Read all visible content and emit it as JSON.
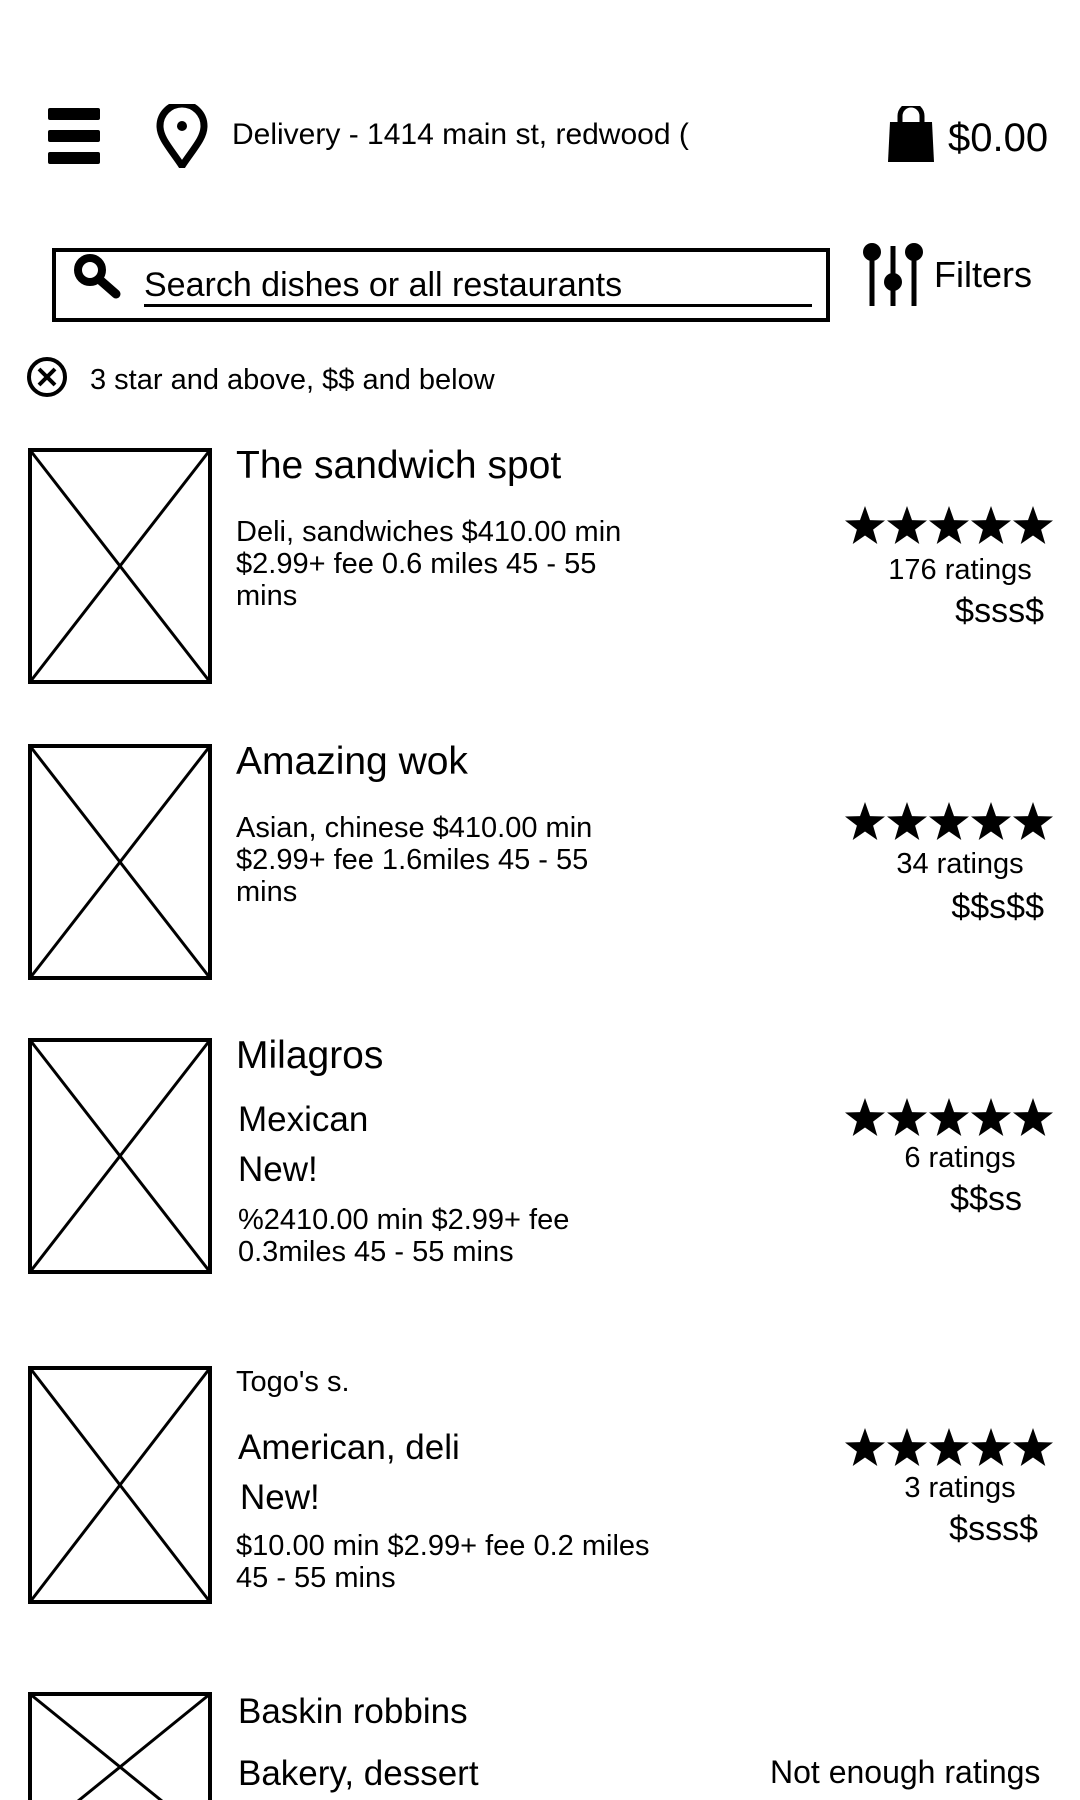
{
  "header": {
    "delivery_address": "Delivery - 1414 main st, redwood (",
    "cart_total": "$0.00"
  },
  "search": {
    "placeholder": "Search dishes or all restaurants",
    "filters_label": "Filters"
  },
  "active_filter": {
    "text": "3 star and above, $$ and below"
  },
  "restaurants": [
    {
      "name": "The sandwich spot",
      "meta": "Deli, sandwiches $410.00 min $2.99+ fee 0.6 miles 45 - 55 mins",
      "stars": 5,
      "ratings": "176 ratings",
      "price": "$sss$"
    },
    {
      "name": "Amazing wok",
      "meta": "Asian, chinese $410.00 min $2.99+ fee 1.6miles 45 - 55 mins",
      "stars": 5,
      "ratings": "34 ratings",
      "price": "$$s$$"
    },
    {
      "name": "Milagros",
      "cuisine": "Mexican",
      "badge": "New!",
      "meta": "%2410.00 min $2.99+ fee 0.3miles 45 - 55 mins",
      "stars": 5,
      "ratings": "6 ratings",
      "price": "$$ss"
    },
    {
      "name": "Togo's s.",
      "cuisine": "American, deli",
      "badge": "New!",
      "meta": "$10.00 min $2.99+ fee 0.2 miles 45 - 55 mins",
      "stars": 5,
      "ratings": "3 ratings",
      "price": "$sss$"
    },
    {
      "name": "Baskin robbins",
      "cuisine": "Bakery, dessert",
      "ratings": "Not enough ratings"
    }
  ],
  "icons": {
    "menu": "hamburger-menu-icon",
    "location": "map-pin-icon",
    "cart": "shopping-bag-icon",
    "search": "magnifier-icon",
    "filters": "sliders-icon",
    "clear": "close-circle-icon",
    "placeholder_image": "image-placeholder-icon",
    "rating": "star-icon"
  }
}
